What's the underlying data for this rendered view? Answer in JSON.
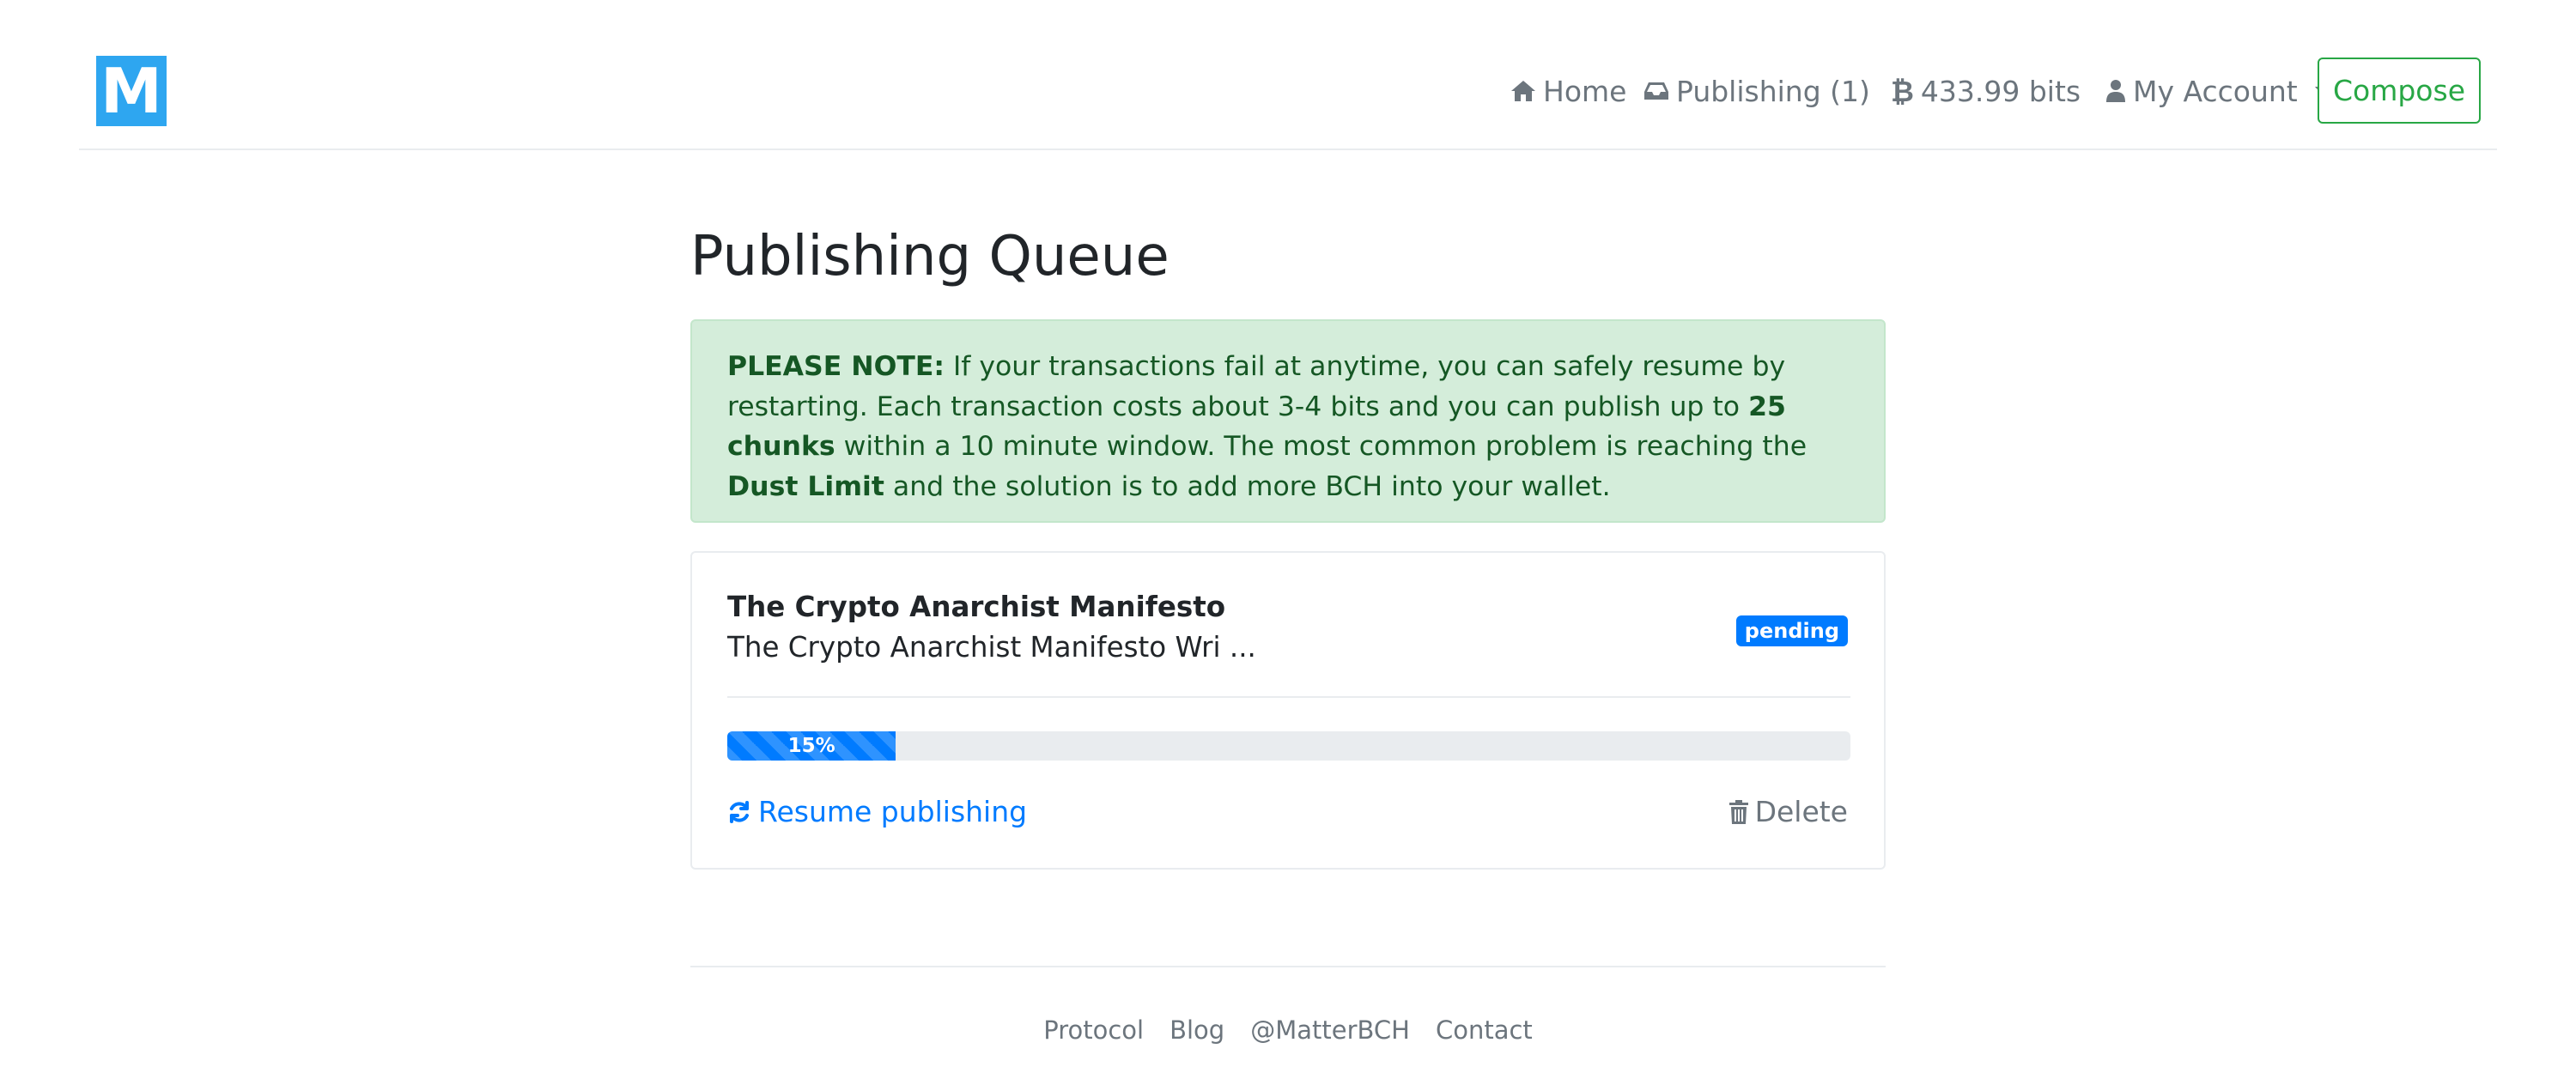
{
  "navbar": {
    "logo_text": "M",
    "items": [
      {
        "label": "Home",
        "icon": "home-icon"
      },
      {
        "label": "Publishing (1)",
        "icon": "inbox-icon"
      },
      {
        "label": "433.99 bits",
        "icon": "bitcoin-icon"
      },
      {
        "label": "My Account",
        "icon": "user-icon"
      }
    ],
    "compose_label": "Compose"
  },
  "main": {
    "title": "Publishing Queue",
    "alert": {
      "lead": "PLEASE NOTE:",
      "text_1": " If your transactions fail at anytime, you can safely resume by restarting. Each transaction costs about 3-4 bits and you can publish up to ",
      "bold_1": "25 chunks",
      "text_2": " within a 10 minute window. The most common problem is reaching the ",
      "bold_2": "Dust Limit",
      "text_3": " and the solution is to add more BCH into your wallet."
    },
    "queue_item": {
      "title": "The Crypto Anarchist Manifesto",
      "excerpt": "The Crypto Anarchist Manifesto Wri ...",
      "status": "pending",
      "progress_percent": 15,
      "progress_label": "15%",
      "resume_label": "Resume publishing",
      "delete_label": "Delete"
    }
  },
  "footer": {
    "links": [
      "Protocol",
      "Blog",
      "@MatterBCH",
      "Contact"
    ]
  },
  "colors": {
    "brand": "#2ea6f0",
    "primary": "#007bff",
    "success": "#28a745",
    "alert_bg": "#d4edda",
    "alert_text": "#155724",
    "muted": "#6c757d"
  }
}
